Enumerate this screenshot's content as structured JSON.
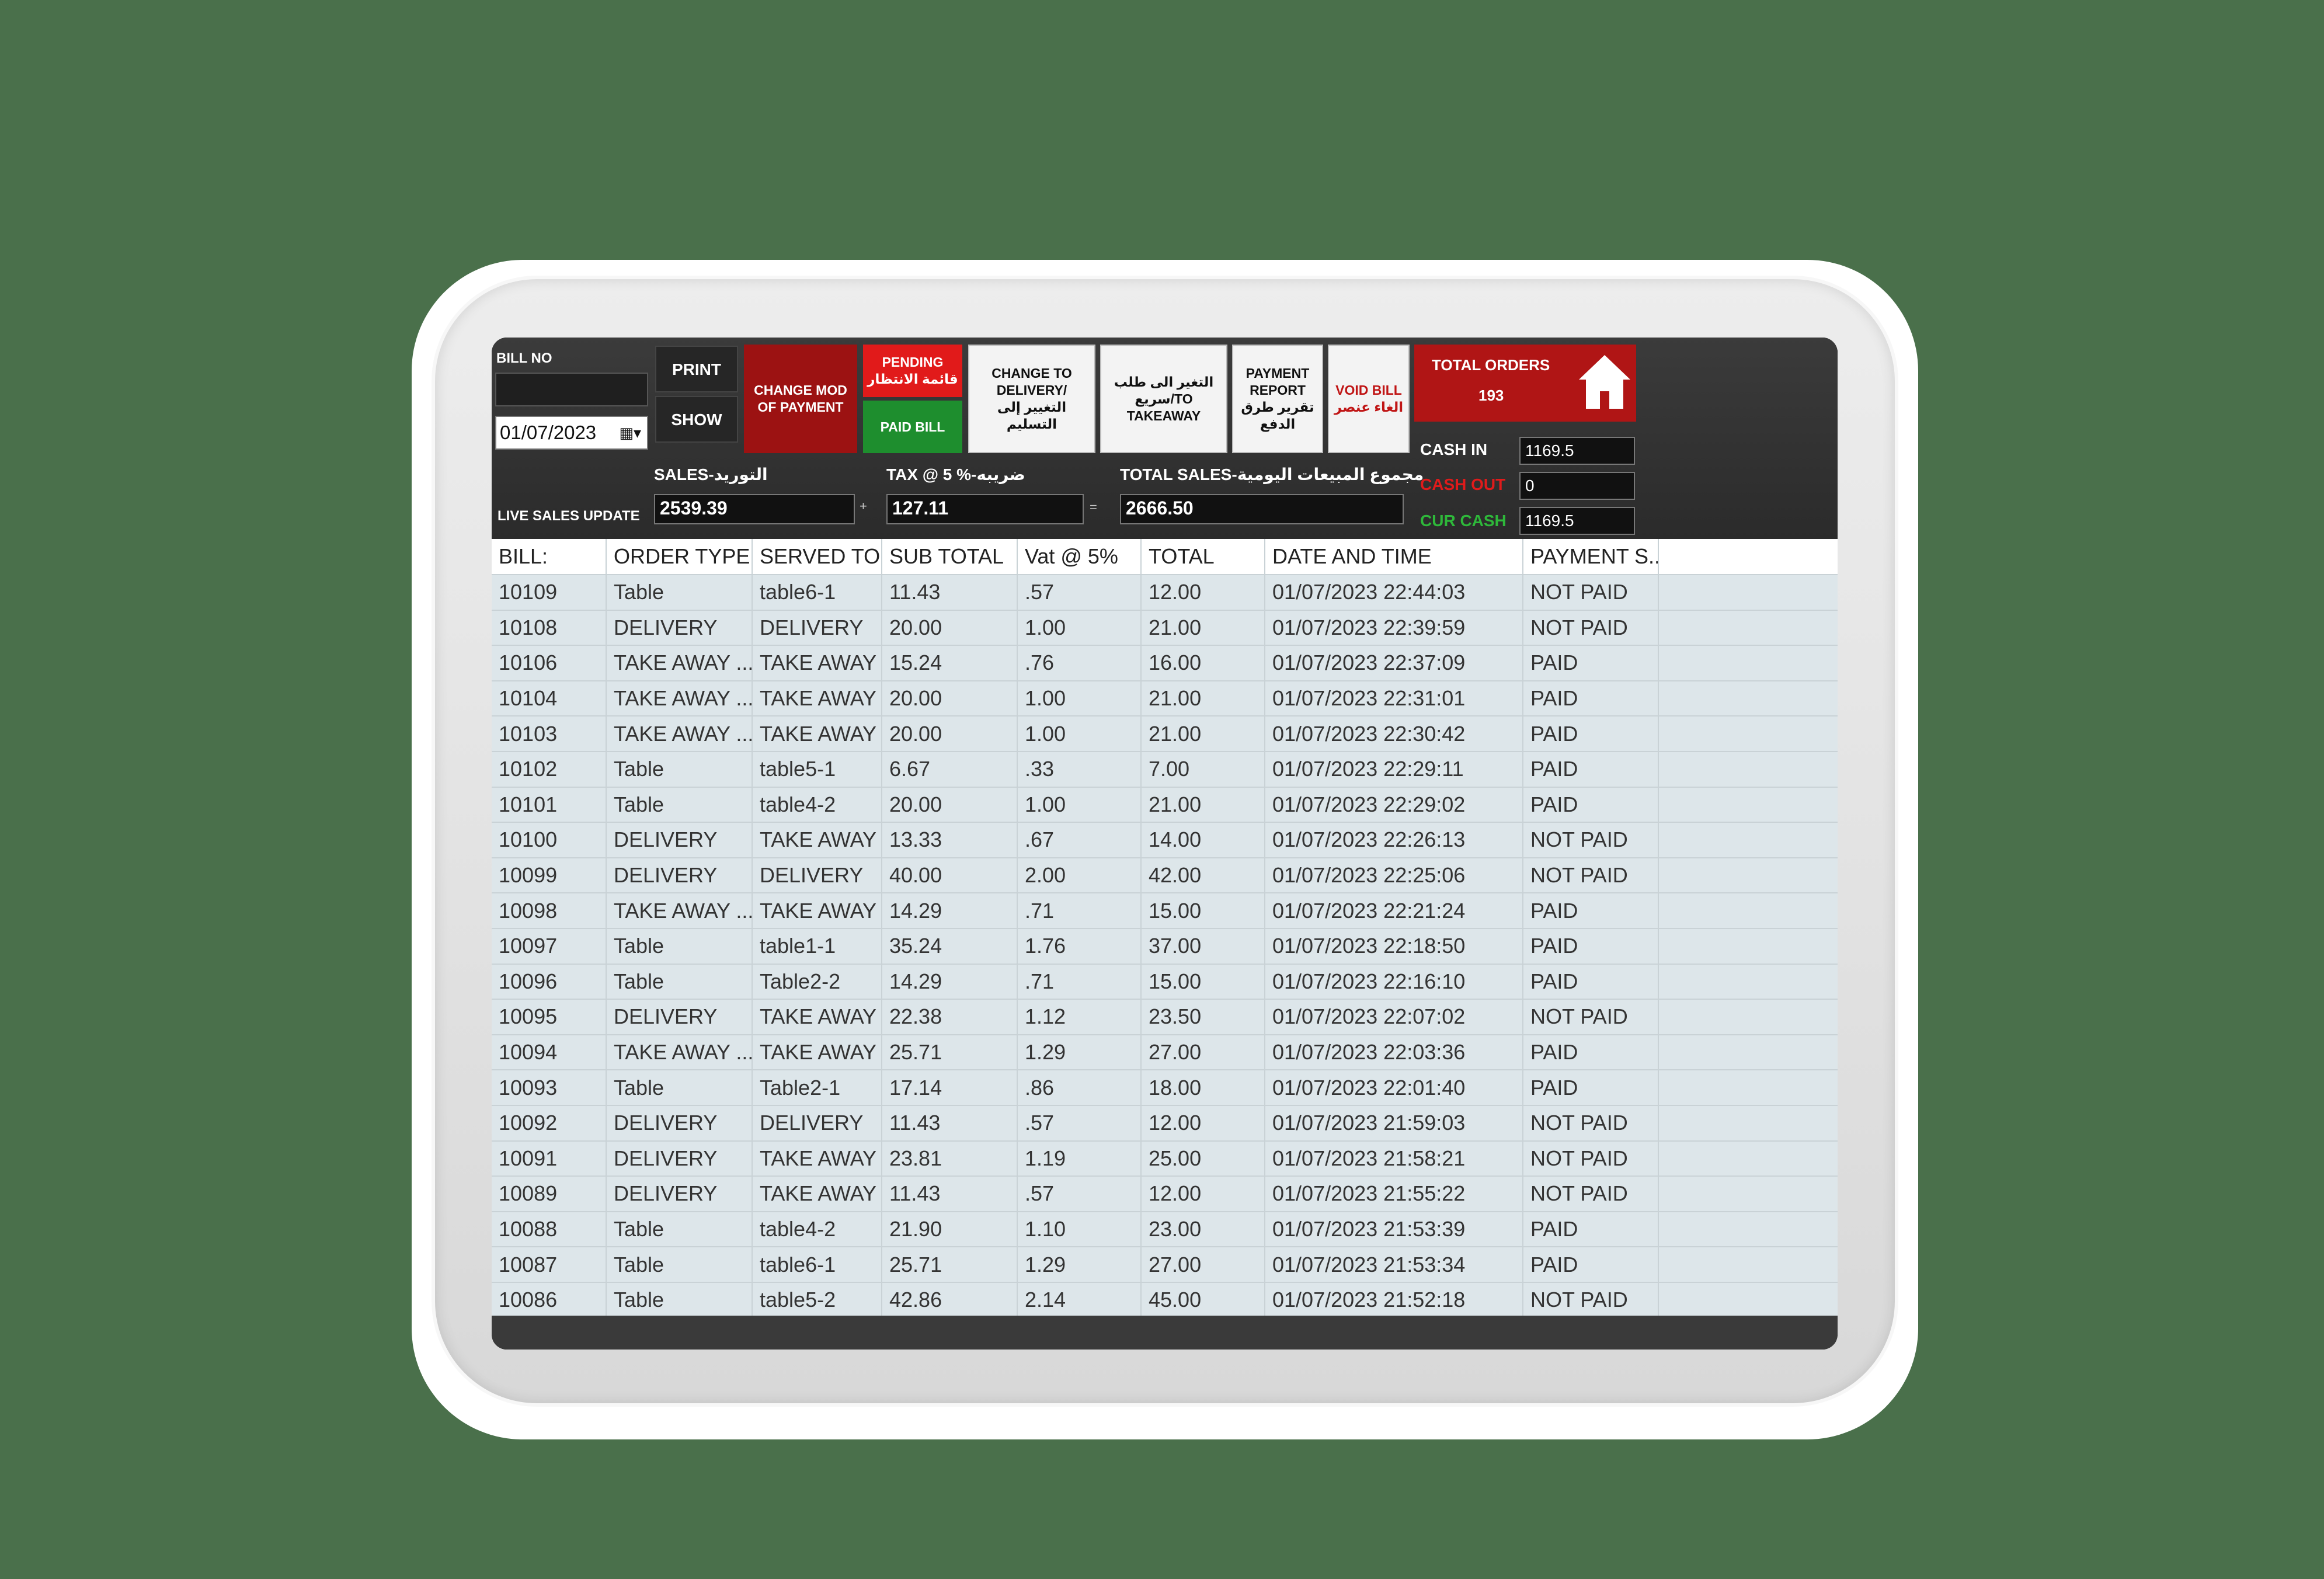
{
  "header": {
    "bill_no_label": "BILL NO",
    "bill_no_value": "",
    "date_value": "01/07/2023",
    "print_label": "PRINT",
    "show_label": "SHOW",
    "change_mod_label": "CHANGE MOD OF PAYMENT",
    "pending_label": "PENDING",
    "pending_label_ar": "قائمة الانتظار",
    "paid_bill_label": "PAID BILL",
    "change_delivery_label": "CHANGE TO DELIVERY/التغيير إلى التسليم",
    "change_takeaway_label": "التغير الى طلب سريع/TO TAKEAWAY",
    "payment_report_label": "PAYMENT REPORT تقرير طرق الدفع",
    "void_bill_label": "VOID BILL",
    "void_bill_label_ar": "الغاء عنصر",
    "total_orders_label": "TOTAL ORDERS",
    "total_orders_value": "193",
    "colors": {
      "accent_red": "#b01515",
      "paid_green": "#1e8e2e",
      "cash_out_red": "#e01b1b",
      "cur_cash_green": "#2eb83a"
    }
  },
  "cash": {
    "cash_in_label": "CASH IN",
    "cash_in_value": "1169.5",
    "cash_out_label": "CASH OUT",
    "cash_out_value": "0",
    "cur_cash_label": "CUR CASH",
    "cur_cash_value": "1169.5"
  },
  "sales": {
    "live_label": "LIVE SALES UPDATE",
    "sales_label": "SALES-التوريد",
    "sales_value": "2539.39",
    "plus": "+",
    "tax_label": "TAX @ 5 %-ضريبه",
    "tax_value": "127.11",
    "equals": "=",
    "total_label": "TOTAL SALES-مجموع المبيعات اليومية",
    "total_value": "2666.50"
  },
  "table": {
    "columns": [
      "BILL:",
      "ORDER TYPE",
      "SERVED TO",
      "SUB TOTAL",
      "Vat @ 5%",
      "TOTAL",
      "DATE AND TIME",
      "PAYMENT S...",
      ""
    ],
    "rows": [
      [
        "10109",
        "Table",
        "table6-1",
        "11.43",
        ".57",
        "12.00",
        "01/07/2023 22:44:03",
        "NOT PAID"
      ],
      [
        "10108",
        "DELIVERY",
        "DELIVERY",
        "20.00",
        "1.00",
        "21.00",
        "01/07/2023 22:39:59",
        "NOT PAID"
      ],
      [
        "10106",
        "TAKE AWAY ...",
        "TAKE AWAY",
        "15.24",
        ".76",
        "16.00",
        "01/07/2023 22:37:09",
        "PAID"
      ],
      [
        "10104",
        "TAKE AWAY ...",
        "TAKE AWAY",
        "20.00",
        "1.00",
        "21.00",
        "01/07/2023 22:31:01",
        "PAID"
      ],
      [
        "10103",
        "TAKE AWAY ...",
        "TAKE AWAY",
        "20.00",
        "1.00",
        "21.00",
        "01/07/2023 22:30:42",
        "PAID"
      ],
      [
        "10102",
        "Table",
        "table5-1",
        "6.67",
        ".33",
        "7.00",
        "01/07/2023 22:29:11",
        "PAID"
      ],
      [
        "10101",
        "Table",
        "table4-2",
        "20.00",
        "1.00",
        "21.00",
        "01/07/2023 22:29:02",
        "PAID"
      ],
      [
        "10100",
        "DELIVERY",
        "TAKE AWAY",
        "13.33",
        ".67",
        "14.00",
        "01/07/2023 22:26:13",
        "NOT PAID"
      ],
      [
        "10099",
        "DELIVERY",
        "DELIVERY",
        "40.00",
        "2.00",
        "42.00",
        "01/07/2023 22:25:06",
        "NOT PAID"
      ],
      [
        "10098",
        "TAKE AWAY ...",
        "TAKE AWAY",
        "14.29",
        ".71",
        "15.00",
        "01/07/2023 22:21:24",
        "PAID"
      ],
      [
        "10097",
        "Table",
        "table1-1",
        "35.24",
        "1.76",
        "37.00",
        "01/07/2023 22:18:50",
        "PAID"
      ],
      [
        "10096",
        "Table",
        "Table2-2",
        "14.29",
        ".71",
        "15.00",
        "01/07/2023 22:16:10",
        "PAID"
      ],
      [
        "10095",
        "DELIVERY",
        "TAKE AWAY",
        "22.38",
        "1.12",
        "23.50",
        "01/07/2023 22:07:02",
        "NOT PAID"
      ],
      [
        "10094",
        "TAKE AWAY ...",
        "TAKE AWAY",
        "25.71",
        "1.29",
        "27.00",
        "01/07/2023 22:03:36",
        "PAID"
      ],
      [
        "10093",
        "Table",
        "Table2-1",
        "17.14",
        ".86",
        "18.00",
        "01/07/2023 22:01:40",
        "PAID"
      ],
      [
        "10092",
        "DELIVERY",
        "DELIVERY",
        "11.43",
        ".57",
        "12.00",
        "01/07/2023 21:59:03",
        "NOT PAID"
      ],
      [
        "10091",
        "DELIVERY",
        "TAKE AWAY",
        "23.81",
        "1.19",
        "25.00",
        "01/07/2023 21:58:21",
        "NOT PAID"
      ],
      [
        "10089",
        "DELIVERY",
        "TAKE AWAY",
        "11.43",
        ".57",
        "12.00",
        "01/07/2023 21:55:22",
        "NOT PAID"
      ],
      [
        "10088",
        "Table",
        "table4-2",
        "21.90",
        "1.10",
        "23.00",
        "01/07/2023 21:53:39",
        "PAID"
      ],
      [
        "10087",
        "Table",
        "table6-1",
        "25.71",
        "1.29",
        "27.00",
        "01/07/2023 21:53:34",
        "PAID"
      ],
      [
        "10086",
        "Table",
        "table5-2",
        "42.86",
        "2.14",
        "45.00",
        "01/07/2023 21:52:18",
        "NOT PAID"
      ]
    ]
  }
}
